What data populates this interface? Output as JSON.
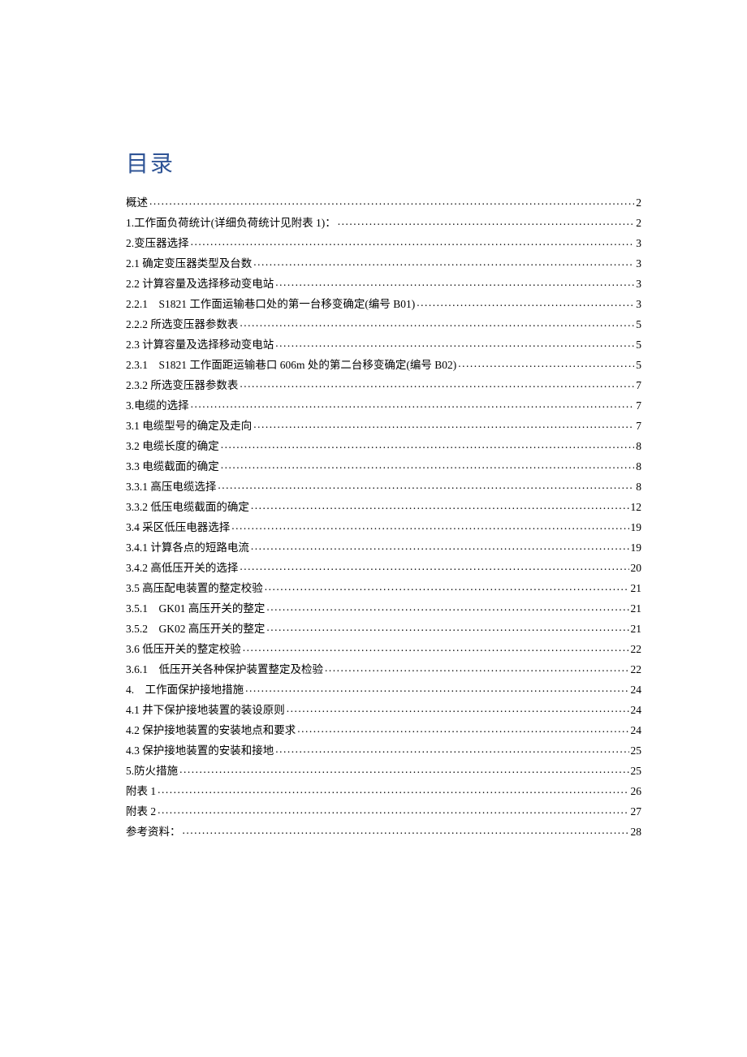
{
  "title": "目录",
  "toc": [
    {
      "label": "概述",
      "page": "2"
    },
    {
      "label": "1.工作面负荷统计(详细负荷统计见附表 1)：",
      "page": "2"
    },
    {
      "label": "2.变压器选择",
      "page": "3"
    },
    {
      "label": "2.1 确定变压器类型及台数",
      "page": "3"
    },
    {
      "label": "2.2 计算容量及选择移动变电站",
      "page": "3"
    },
    {
      "label": "2.2.1　S1821 工作面运输巷口处的第一台移变确定(编号 B01)",
      "page": "3"
    },
    {
      "label": "2.2.2 所选变压器参数表",
      "page": "5"
    },
    {
      "label": "2.3 计算容量及选择移动变电站",
      "page": "5"
    },
    {
      "label": "2.3.1　S1821 工作面距运输巷口 606m 处的第二台移变确定(编号 B02)",
      "page": "5"
    },
    {
      "label": "2.3.2 所选变压器参数表",
      "page": "7"
    },
    {
      "label": "3.电缆的选择",
      "page": "7"
    },
    {
      "label": "3.1 电缆型号的确定及走向",
      "page": "7"
    },
    {
      "label": "3.2 电缆长度的确定",
      "page": "8"
    },
    {
      "label": "3.3 电缆截面的确定",
      "page": "8"
    },
    {
      "label": "3.3.1 高压电缆选择",
      "page": "8"
    },
    {
      "label": "3.3.2 低压电缆截面的确定",
      "page": "12"
    },
    {
      "label": "3.4 采区低压电器选择",
      "page": "19"
    },
    {
      "label": "3.4.1 计算各点的短路电流",
      "page": "19"
    },
    {
      "label": "3.4.2 高低压开关的选择",
      "page": "20"
    },
    {
      "label": "3.5 高压配电装置的整定校验",
      "page": "21"
    },
    {
      "label": "3.5.1　GK01 高压开关的整定",
      "page": "21"
    },
    {
      "label": "3.5.2　GK02 高压开关的整定",
      "page": "21"
    },
    {
      "label": "3.6 低压开关的整定校验",
      "page": "22"
    },
    {
      "label": "3.6.1　低压开关各种保护装置整定及检验",
      "page": "22"
    },
    {
      "label": "4.　工作面保护接地措施",
      "page": "24"
    },
    {
      "label": "4.1 井下保护接地装置的装设原则",
      "page": "24"
    },
    {
      "label": "4.2 保护接地装置的安装地点和要求",
      "page": "24"
    },
    {
      "label": "4.3 保护接地装置的安装和接地",
      "page": "25"
    },
    {
      "label": "5.防火措施",
      "page": "25"
    },
    {
      "label": "附表 1",
      "page": "26"
    },
    {
      "label": "附表 2",
      "page": "27"
    },
    {
      "label": "参考资料：",
      "page": "28"
    }
  ]
}
